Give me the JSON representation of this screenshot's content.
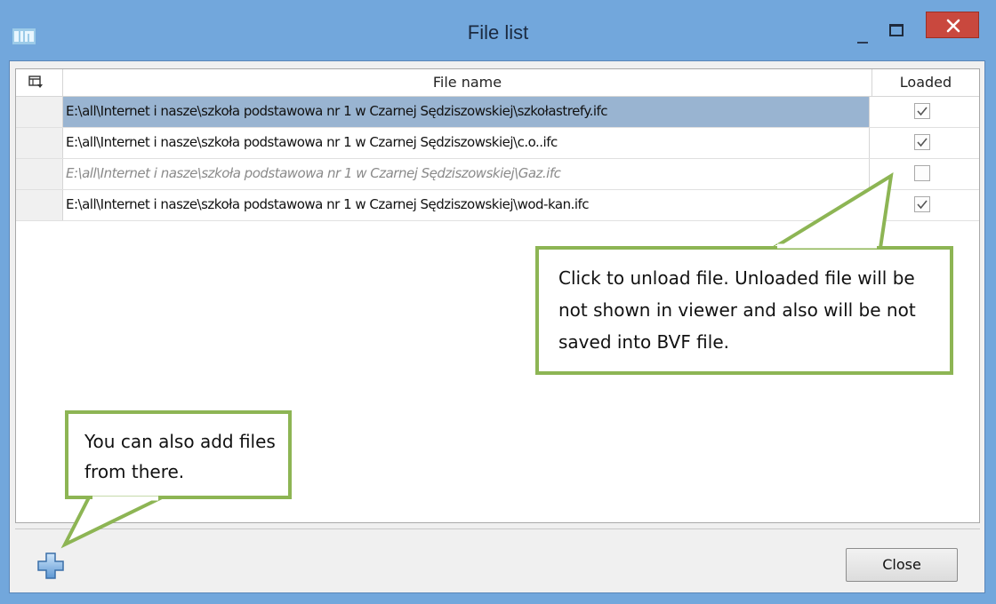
{
  "window": {
    "title": "File list",
    "app_icon": "bim-app-icon",
    "controls": [
      "minimize-icon",
      "maximize-icon",
      "close-icon"
    ],
    "accent_color": "#72a7dc",
    "close_color": "#c9483e"
  },
  "grid": {
    "header_icon": "column-chooser-icon",
    "columns": [
      "File name",
      "Loaded"
    ],
    "rows": [
      {
        "file": "E:\\all\\Internet i nasze\\szkoła podstawowa nr 1 w Czarnej Sędziszowskiej\\szkołastrefy.ifc",
        "loaded": true,
        "selected": true
      },
      {
        "file": "E:\\all\\Internet i nasze\\szkoła podstawowa nr 1 w Czarnej Sędziszowskiej\\c.o..ifc",
        "loaded": true,
        "selected": false
      },
      {
        "file": "E:\\all\\Internet i nasze\\szkoła podstawowa nr 1 w Czarnej Sędziszowskiej\\Gaz.ifc",
        "loaded": false,
        "selected": false
      },
      {
        "file": "E:\\all\\Internet i nasze\\szkoła podstawowa nr 1 w Czarnej Sędziszowskiej\\wod-kan.ifc",
        "loaded": true,
        "selected": false
      }
    ],
    "selection_color": "#99b4d1"
  },
  "footer": {
    "add_icon": "add-file-plus-icon",
    "close_label": "Close"
  },
  "callouts": {
    "unload": "Click to unload file. Unloaded file will be not shown in viewer and also will be not saved into BVF file.",
    "add": "You can also add files from there.",
    "border_color": "#8db554"
  }
}
